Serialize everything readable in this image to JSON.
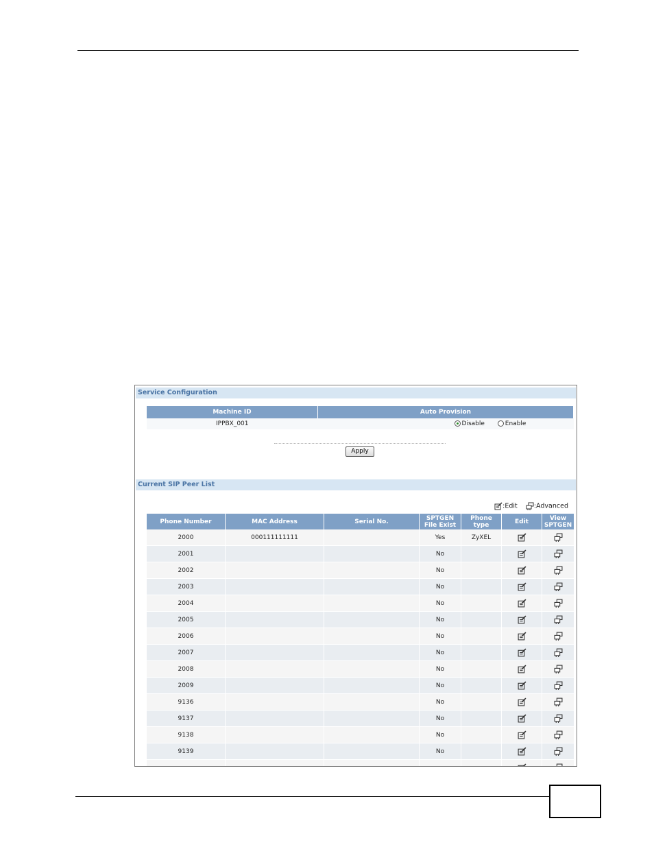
{
  "service_configuration": {
    "title": "Service Configuration",
    "columns": {
      "machine_id": "Machine ID",
      "auto_provision": "Auto Provision"
    },
    "machine_id_value": "IPPBX_001",
    "auto_provision_options": [
      {
        "label": "Disable",
        "selected": true
      },
      {
        "label": "Enable",
        "selected": false
      }
    ],
    "apply_label": "Apply"
  },
  "sip_peer_list": {
    "title": "Current SIP Peer List",
    "legend": {
      "edit": ":Edit",
      "advanced": ":Advanced"
    },
    "columns": {
      "phone_number": "Phone Number",
      "mac_address": "MAC Address",
      "serial_no": "Serial No.",
      "sptgen_line1": "SPTGEN",
      "sptgen_line2": "File Exist",
      "phone_type_line1": "Phone",
      "phone_type_line2": "type",
      "edit": "Edit",
      "view_line1": "View",
      "view_line2": "SPTGEN"
    },
    "rows": [
      {
        "phone": "2000",
        "mac": "000111111111",
        "serial": "",
        "sptgen": "Yes",
        "type": "ZyXEL"
      },
      {
        "phone": "2001",
        "mac": "",
        "serial": "",
        "sptgen": "No",
        "type": ""
      },
      {
        "phone": "2002",
        "mac": "",
        "serial": "",
        "sptgen": "No",
        "type": ""
      },
      {
        "phone": "2003",
        "mac": "",
        "serial": "",
        "sptgen": "No",
        "type": ""
      },
      {
        "phone": "2004",
        "mac": "",
        "serial": "",
        "sptgen": "No",
        "type": ""
      },
      {
        "phone": "2005",
        "mac": "",
        "serial": "",
        "sptgen": "No",
        "type": ""
      },
      {
        "phone": "2006",
        "mac": "",
        "serial": "",
        "sptgen": "No",
        "type": ""
      },
      {
        "phone": "2007",
        "mac": "",
        "serial": "",
        "sptgen": "No",
        "type": ""
      },
      {
        "phone": "2008",
        "mac": "",
        "serial": "",
        "sptgen": "No",
        "type": ""
      },
      {
        "phone": "2009",
        "mac": "",
        "serial": "",
        "sptgen": "No",
        "type": ""
      },
      {
        "phone": "9136",
        "mac": "",
        "serial": "",
        "sptgen": "No",
        "type": ""
      },
      {
        "phone": "9137",
        "mac": "",
        "serial": "",
        "sptgen": "No",
        "type": ""
      },
      {
        "phone": "9138",
        "mac": "",
        "serial": "",
        "sptgen": "No",
        "type": ""
      },
      {
        "phone": "9139",
        "mac": "",
        "serial": "",
        "sptgen": "No",
        "type": ""
      },
      {
        "phone": "",
        "mac": "",
        "serial": "",
        "sptgen": "",
        "type": ""
      }
    ]
  }
}
